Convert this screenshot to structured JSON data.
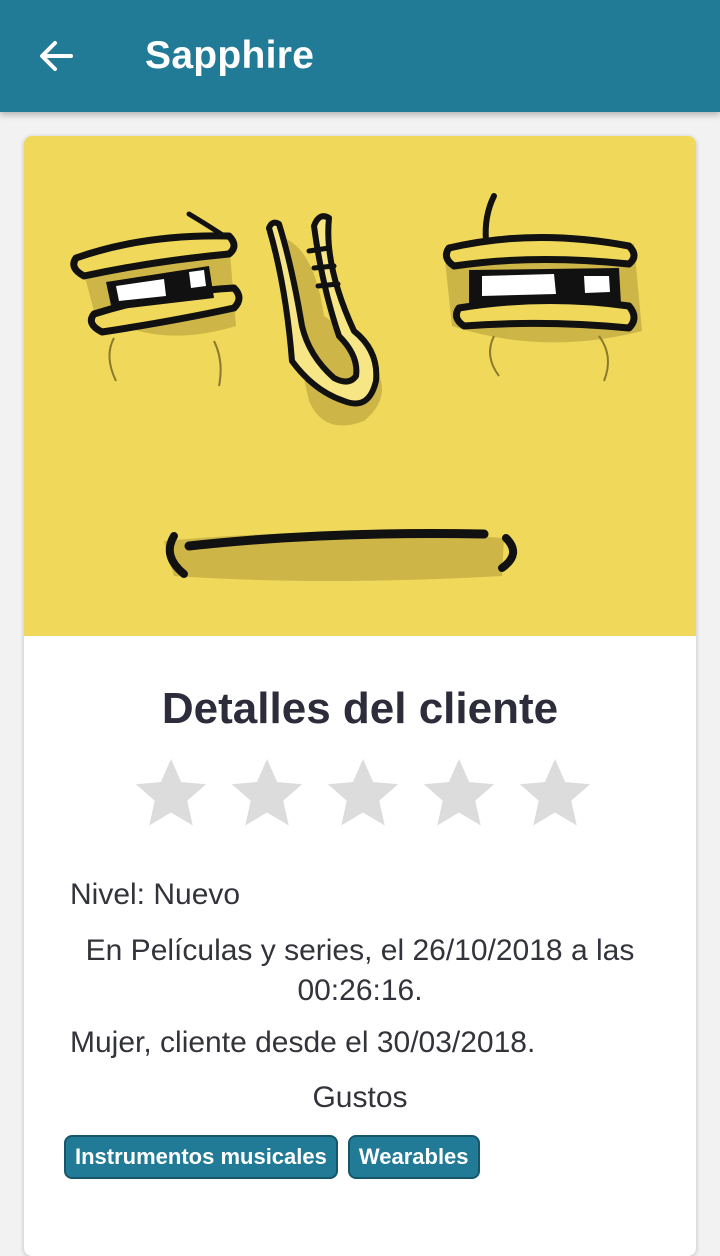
{
  "app_bar": {
    "title": "Sapphire",
    "back_icon": "arrow-back-icon",
    "background": "#227b96"
  },
  "avatar": {
    "icon": "face-avatar",
    "background": "#f0d85a"
  },
  "client": {
    "title": "Detalles del cliente",
    "rating": 0,
    "rating_max": 5,
    "level": "Nivel: Nuevo",
    "last_visit": "En Películas y series, el 26/10/2018 a las 00:26:16.",
    "since": "Mujer, cliente desde el 30/03/2018.",
    "likes_title": "Gustos",
    "likes": [
      "Instrumentos musicales",
      "Wearables"
    ]
  }
}
